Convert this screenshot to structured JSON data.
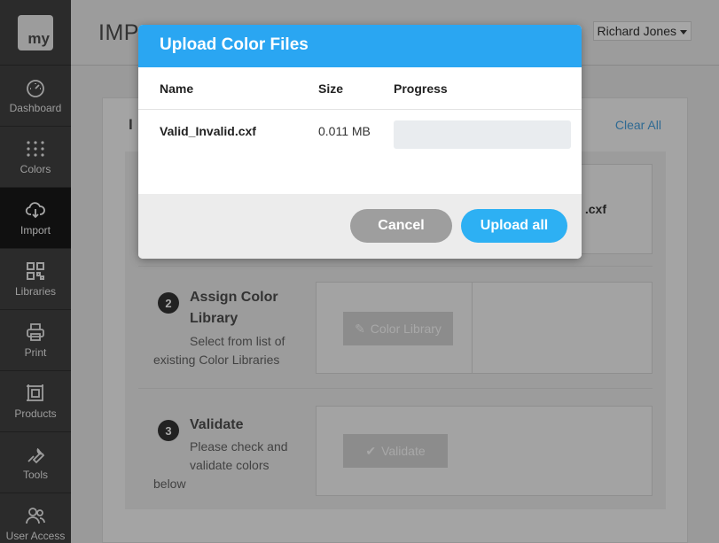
{
  "sidebar": {
    "logo": "my",
    "items": [
      {
        "label": "Dashboard",
        "icon": "gauge-icon"
      },
      {
        "label": "Colors",
        "icon": "dots-grid-icon"
      },
      {
        "label": "Import",
        "icon": "cloud-download-icon",
        "active": true
      },
      {
        "label": "Libraries",
        "icon": "qr-code-icon"
      },
      {
        "label": "Print",
        "icon": "printer-icon"
      },
      {
        "label": "Products",
        "icon": "product-frame-icon"
      },
      {
        "label": "Tools",
        "icon": "wrench-icon"
      },
      {
        "label": "User Access",
        "icon": "users-icon"
      }
    ]
  },
  "topbar": {
    "title": "IMP",
    "user": "Richard Jones"
  },
  "card": {
    "title": "I",
    "clear_all": "Clear All"
  },
  "steps": {
    "step1": {
      "file_tail": ".cxf"
    },
    "step2": {
      "number": "2",
      "title_line1": "Assign Color",
      "title_line2": "Library",
      "desc_line1": "Select from list of",
      "desc_line2": "existing Color Libraries",
      "button": "Color Library"
    },
    "step3": {
      "number": "3",
      "title": "Validate",
      "desc_line1": "Please check and",
      "desc_line2": "validate colors",
      "desc_line3": "below",
      "button": "Validate"
    }
  },
  "modal": {
    "title": "Upload Color Files",
    "columns": {
      "name": "Name",
      "size": "Size",
      "progress": "Progress"
    },
    "files": [
      {
        "name": "Valid_Invalid.cxf",
        "size": "0.011 MB",
        "progress": 0
      }
    ],
    "cancel": "Cancel",
    "upload_all": "Upload all"
  },
  "colors": {
    "accent": "#2aa6f2",
    "cancel": "#9e9e9e",
    "sidebar": "#2b2b2b"
  }
}
